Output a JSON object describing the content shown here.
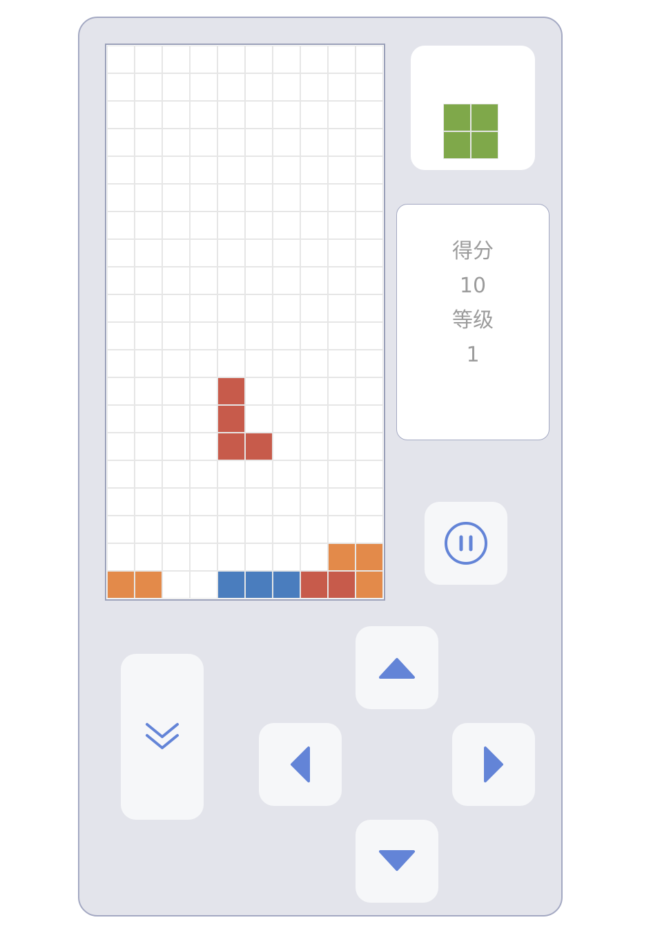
{
  "colors": {
    "orange": "#e38a4a",
    "red": "#c75b4b",
    "blue": "#4a7dbe",
    "green": "#7fa84a",
    "accent": "#6384d7"
  },
  "board": {
    "rows": 20,
    "cols": 10,
    "cells": [
      {
        "r": 12,
        "c": 4,
        "color": "red"
      },
      {
        "r": 13,
        "c": 4,
        "color": "red"
      },
      {
        "r": 14,
        "c": 4,
        "color": "red"
      },
      {
        "r": 14,
        "c": 5,
        "color": "red"
      },
      {
        "r": 18,
        "c": 8,
        "color": "orange"
      },
      {
        "r": 18,
        "c": 9,
        "color": "orange"
      },
      {
        "r": 19,
        "c": 0,
        "color": "orange"
      },
      {
        "r": 19,
        "c": 1,
        "color": "orange"
      },
      {
        "r": 19,
        "c": 4,
        "color": "blue"
      },
      {
        "r": 19,
        "c": 5,
        "color": "blue"
      },
      {
        "r": 19,
        "c": 6,
        "color": "blue"
      },
      {
        "r": 19,
        "c": 7,
        "color": "red"
      },
      {
        "r": 19,
        "c": 8,
        "color": "red"
      },
      {
        "r": 19,
        "c": 9,
        "color": "orange"
      }
    ]
  },
  "next_piece": {
    "color": "green",
    "cells": [
      {
        "r": 0,
        "c": 0
      },
      {
        "r": 0,
        "c": 1
      },
      {
        "r": 1,
        "c": 0
      },
      {
        "r": 1,
        "c": 1
      }
    ]
  },
  "stats": {
    "score_label": "得分",
    "score": "10",
    "level_label": "等级",
    "level": "1"
  },
  "controls": {
    "pause_icon": "pause-icon",
    "drop_icon": "double-chevron-down-icon",
    "up_icon": "triangle-up-icon",
    "left_icon": "triangle-left-icon",
    "right_icon": "triangle-right-icon",
    "down_icon": "triangle-down-icon"
  }
}
